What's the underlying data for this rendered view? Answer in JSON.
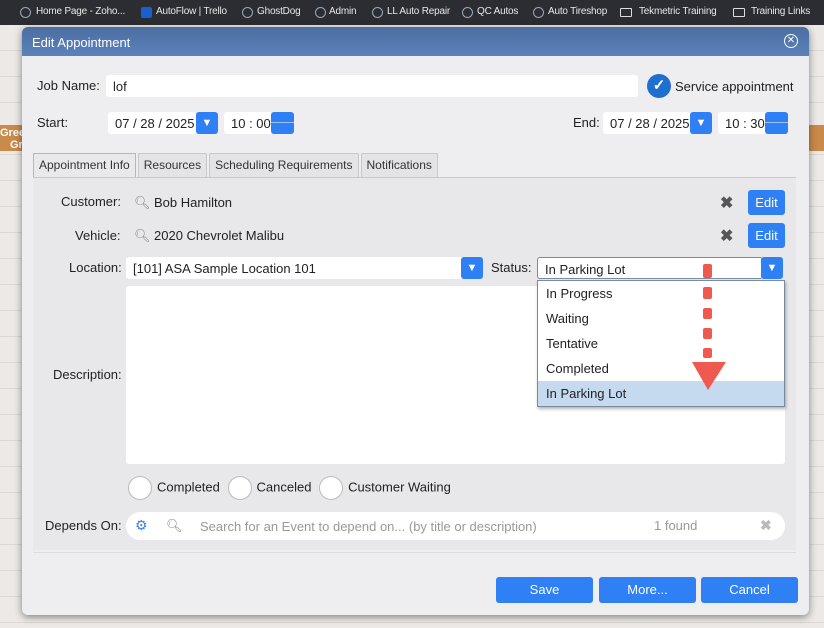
{
  "bookmarks": [
    "Home Page - Zoho...",
    "AutoFlow | Trello",
    "GhostDog",
    "Admin",
    "LL Auto Repair",
    "QC Autos",
    "Auto Tireshop",
    "Tekmetric Training",
    "Training Links"
  ],
  "background": {
    "row_text1": "Gree",
    "row_text2": "Gr"
  },
  "dialog": {
    "title": "Edit Appointment",
    "job_name_label": "Job Name:",
    "job_name": "lof",
    "service_appt_label": "Service appointment",
    "start_label": "Start:",
    "start_date": "07 / 28 / 2025",
    "start_time": "10 : 00",
    "end_label": "End:",
    "end_date": "07 / 28 / 2025",
    "end_time": "10 : 30",
    "tabs": [
      "Appointment Info",
      "Resources",
      "Scheduling Requirements",
      "Notifications"
    ],
    "customer_label": "Customer:",
    "customer": "Bob Hamilton",
    "vehicle_label": "Vehicle:",
    "vehicle": "2020 Chevrolet Malibu",
    "edit_label": "Edit",
    "location_label": "Location:",
    "location": "[101] ASA Sample Location 101",
    "status_label": "Status:",
    "status": "In Parking Lot",
    "status_options": [
      "In Progress",
      "Waiting",
      "Tentative",
      "Completed",
      "In Parking Lot"
    ],
    "description_label": "Description:",
    "flags": [
      "Completed",
      "Canceled",
      "Customer Waiting"
    ],
    "depends_label": "Depends On:",
    "depends_placeholder": "Search for an Event to depend on... (by title or description)",
    "found": "1 found",
    "buttons": {
      "save": "Save",
      "more": "More...",
      "cancel": "Cancel"
    }
  }
}
